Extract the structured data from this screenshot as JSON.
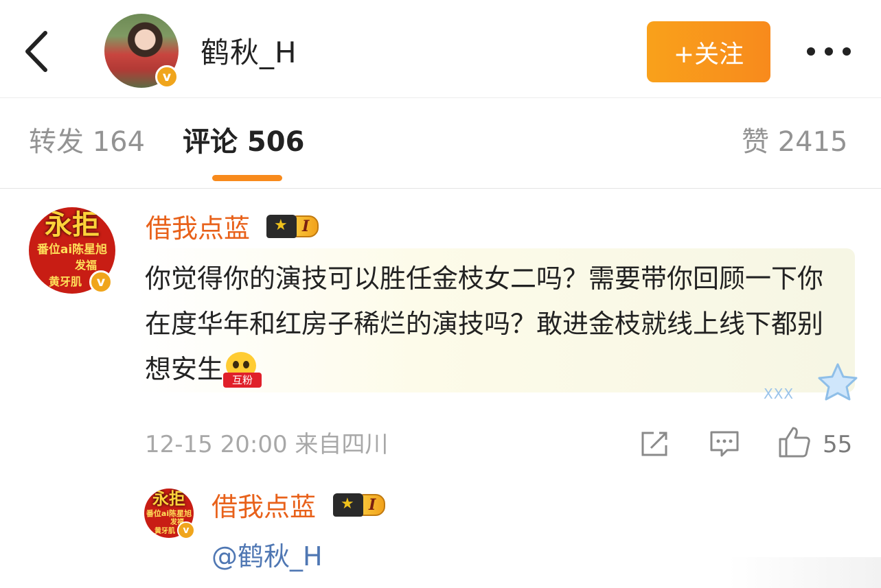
{
  "header": {
    "back_icon": "chevron-left-icon",
    "username": "鹤秋_H",
    "verified_icon": "v",
    "follow_label": "+关注",
    "more_icon": "more-dots-icon",
    "accent": "#f88a1c"
  },
  "tabs": {
    "repost": "转发 164",
    "comments": "评论 506",
    "likes": "赞 2415",
    "active": "comments"
  },
  "comment": {
    "username": "借我点蓝",
    "level": "I",
    "avatar_text": {
      "main": "永拒",
      "sub1": "番位ai陈星旭",
      "sub2": "发福",
      "sub3": "黄牙肌"
    },
    "text": "你觉得你的演技可以胜任金枝女二吗？需要带你回顾一下你在度华年和红房子稀烂的演技吗？敢进金枝就线上线下都别想安生",
    "emoji_tag": "互粉",
    "card_deco": "XXX",
    "meta": "12-15 20:00 来自四川",
    "like_count": "55",
    "username_color": "#e8611a"
  },
  "reply": {
    "username": "借我点蓝",
    "level": "I",
    "avatar_text": {
      "main": "永拒",
      "sub1": "番位ai陈星旭",
      "sub2": "发福",
      "sub3": "黄牙肌"
    },
    "text": "@鹤秋_H",
    "mention_color": "#4f77b3"
  }
}
